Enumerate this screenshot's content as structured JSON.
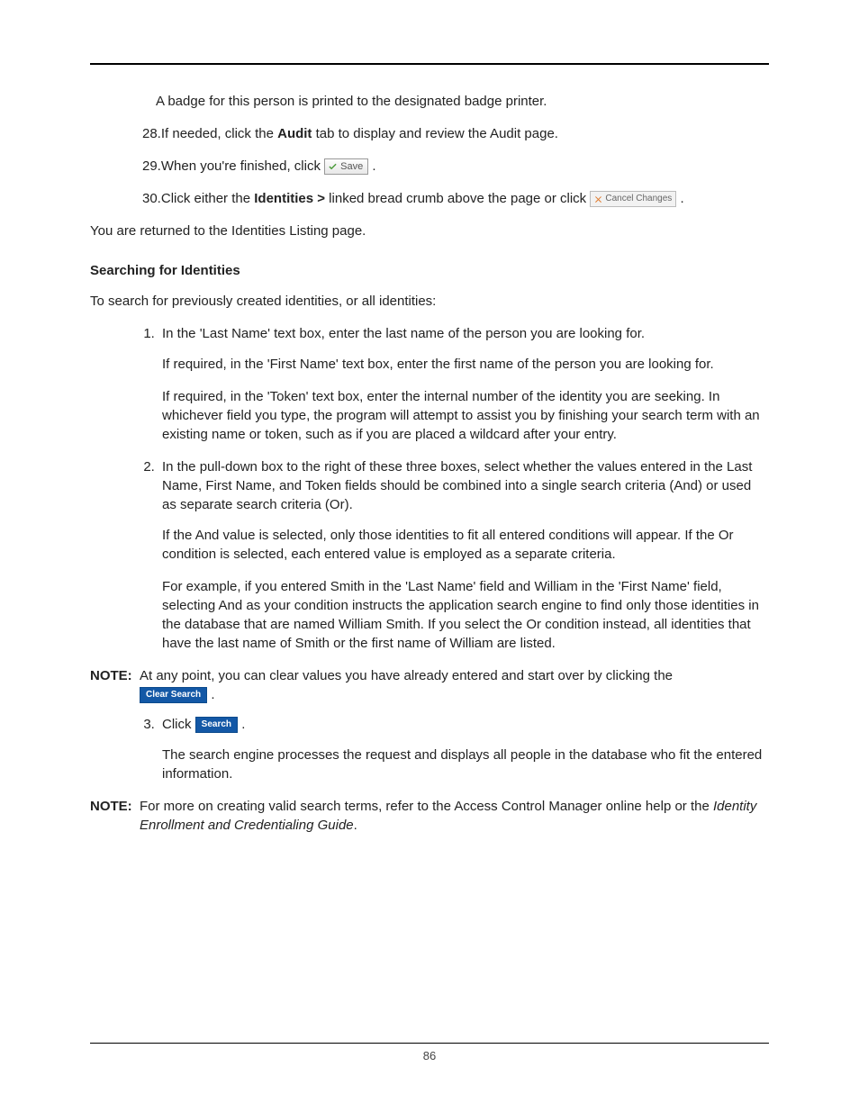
{
  "intro_badge": "A badge for this person is printed to the designated badge printer.",
  "step28_pre": "If needed, click the ",
  "step28_bold": "Audit",
  "step28_post": " tab to display and review the Audit page.",
  "step29_pre": "When you're finished, click ",
  "step30_pre": "Click either the ",
  "step30_bold": "Identities >",
  "step30_mid": " linked bread crumb above the page or click ",
  "returned": "You are returned to the Identities Listing page.",
  "section_heading": "Searching for Identities",
  "section_intro": "To search for previously created identities, or all identities:",
  "s1_a": "In the 'Last Name' text box, enter the last name of the person you are looking for.",
  "s1_b": "If required, in the 'First Name' text box, enter the first name of the person you are looking for.",
  "s1_c": "If required, in the 'Token' text box, enter the internal number of the identity you are seeking. In whichever field you type, the program will attempt to assist you by finishing your search term with an existing name or token, such as if you are placed a wildcard after your entry.",
  "s2_a": "In the pull-down box to the right of these three boxes, select whether the values entered in the Last Name, First Name, and Token fields should be combined into a single search criteria (And) or used as separate search criteria (Or).",
  "s2_b": "If the And value is selected, only those identities to fit all entered conditions will appear. If the Or condition is selected, each entered value is employed as a separate criteria.",
  "s2_c": "For example, if you entered Smith in the 'Last Name' field and William in the 'First Name' field, selecting And as your condition instructs the application search engine to find only those identities in the database that are named William Smith. If you select the Or condition instead, all identities that have the last name of Smith or the first name of William are listed.",
  "note1_label": "NOTE:",
  "note1_text": "At any point, you can clear values you have already entered and start over by clicking the ",
  "s3_pre": "Click ",
  "s3_post": "The search engine processes the request and displays all people in the database who fit the entered information.",
  "note2_label": "NOTE:",
  "note2_pre": "For more on creating valid search terms, refer to the Access Control Manager online help or the ",
  "note2_em": "Identity Enrollment and Credentialing Guide",
  "buttons": {
    "save": "Save",
    "cancel_changes": "Cancel Changes",
    "clear_search": "Clear Search",
    "search": "Search"
  },
  "page_number": "86"
}
